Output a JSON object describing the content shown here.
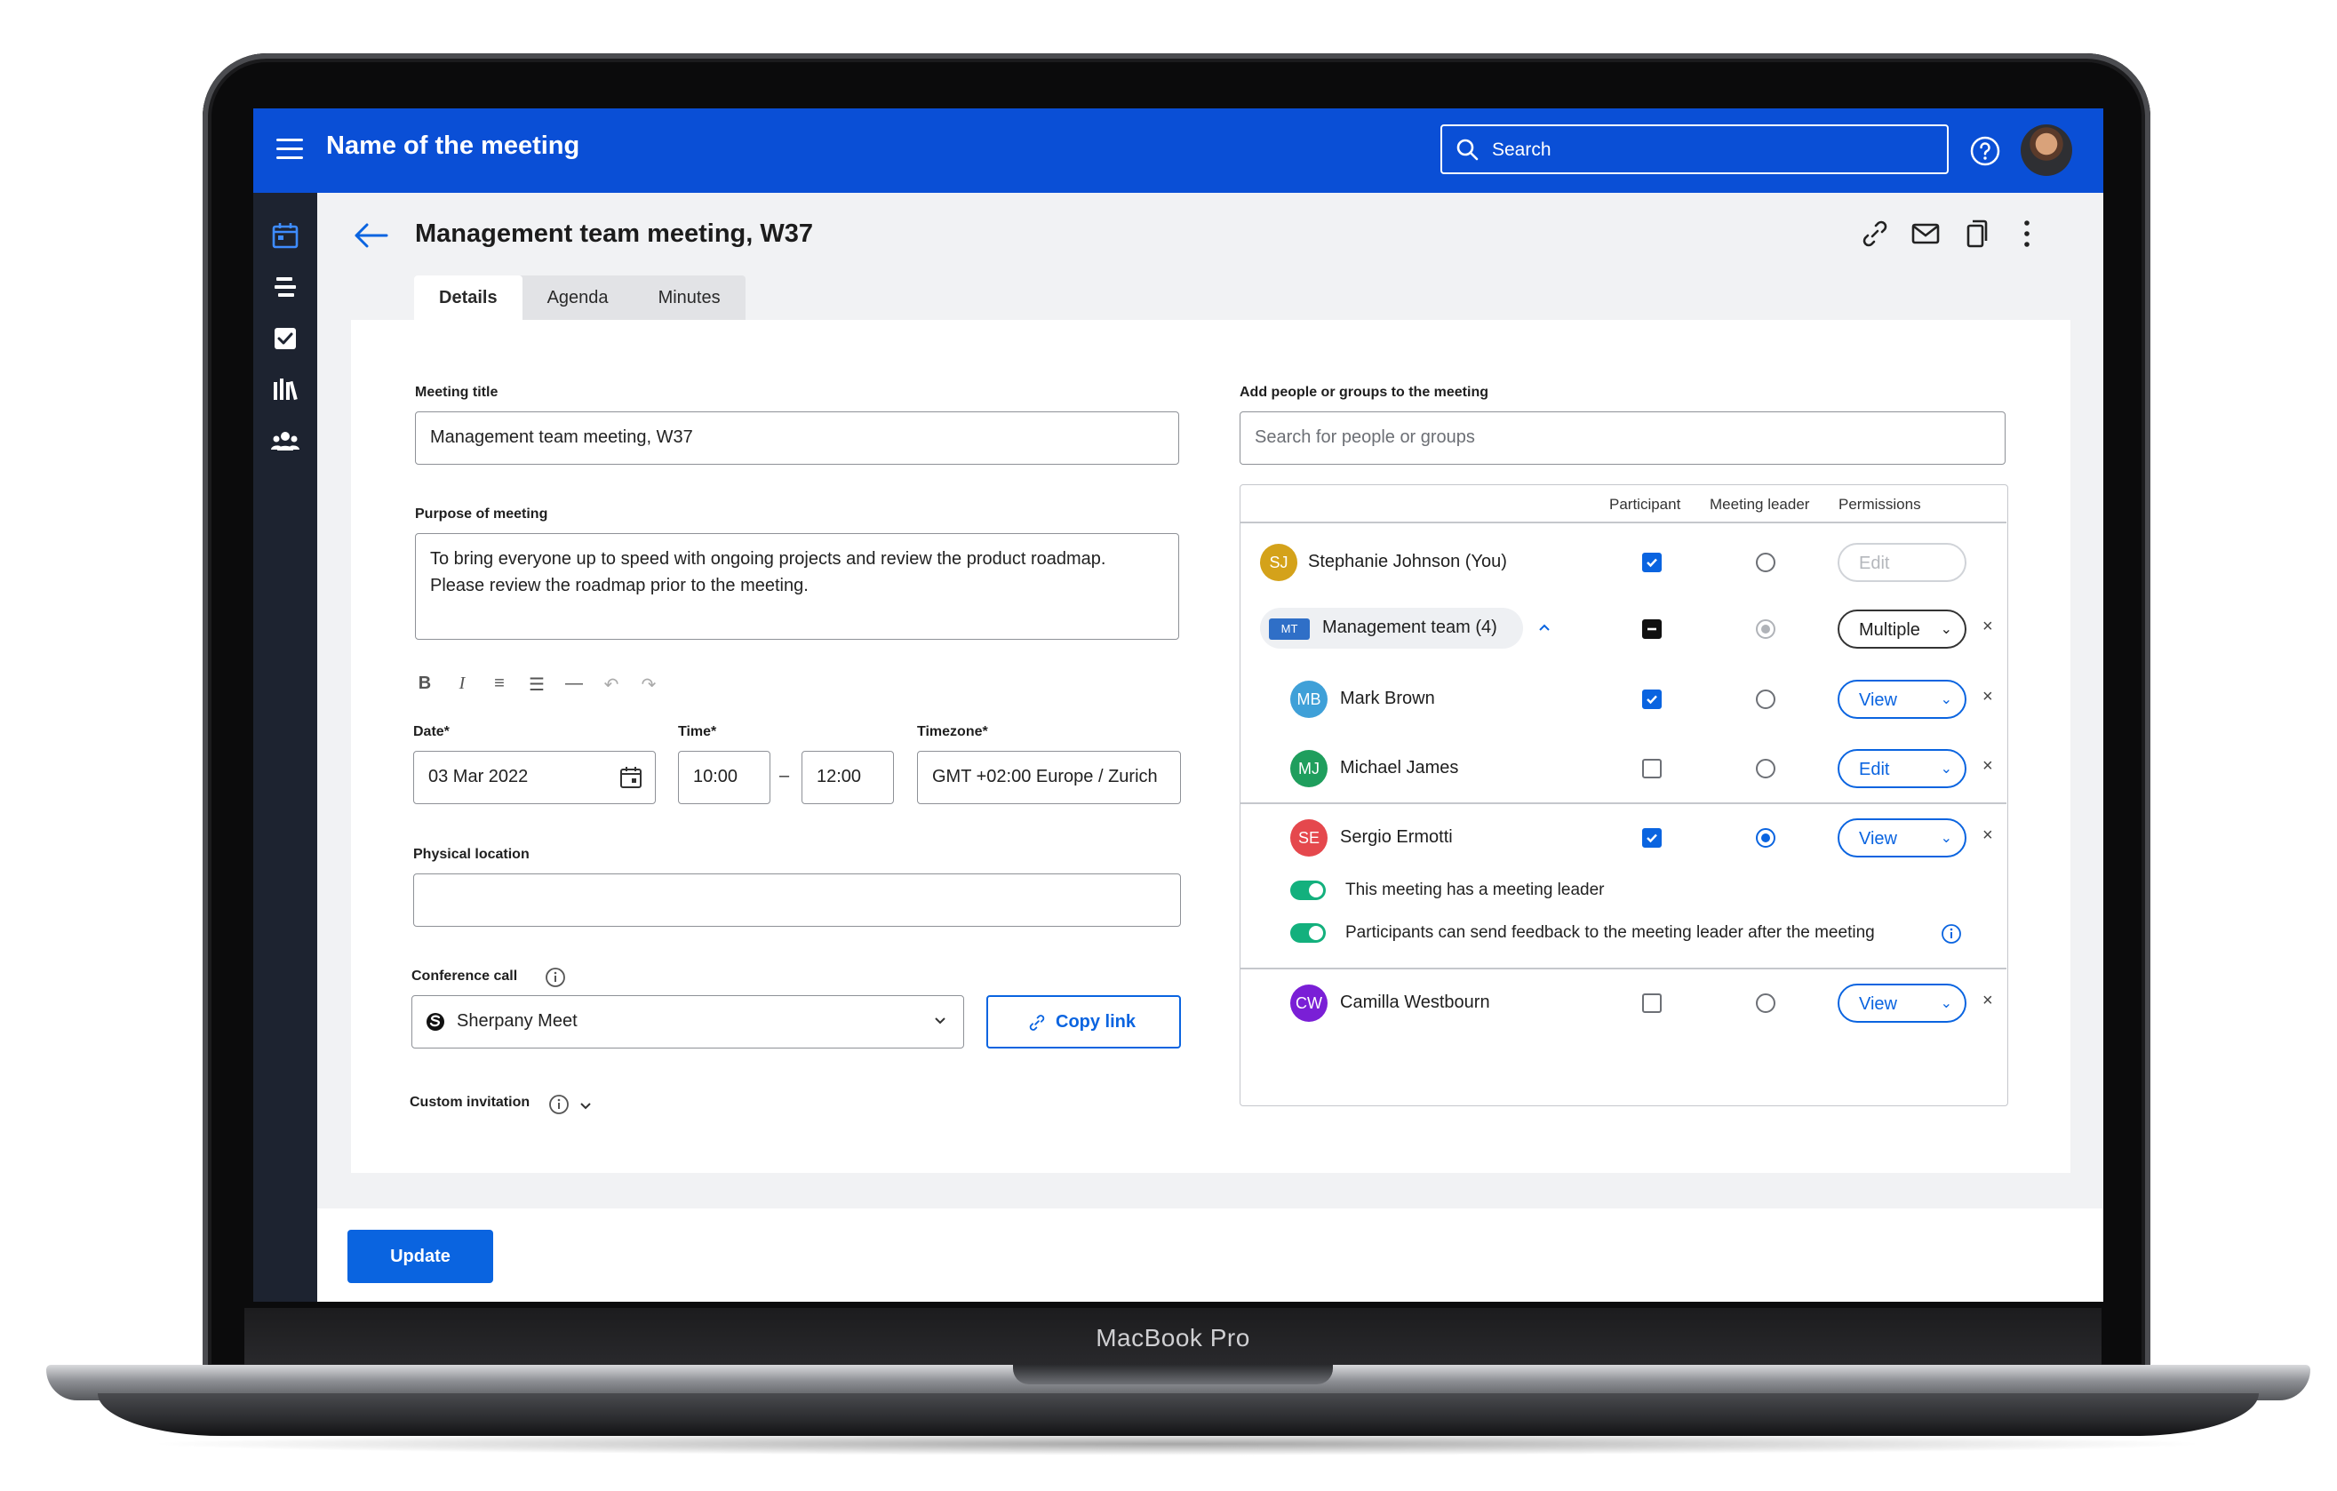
{
  "device": {
    "brand_label": "MacBook Pro"
  },
  "header": {
    "app_title": "Name of the meeting",
    "search_placeholder": "Search",
    "icons": [
      "menu-icon",
      "search-icon",
      "help-icon",
      "avatar"
    ]
  },
  "sidebar": {
    "items": [
      "calendar-icon",
      "agenda-list-icon",
      "tasks-check-icon",
      "library-icon",
      "people-icon"
    ]
  },
  "page": {
    "title": "Management team meeting, W37",
    "actions": [
      "link-icon",
      "mail-icon",
      "copy-icon",
      "more-icon"
    ],
    "tabs": [
      {
        "label": "Details",
        "active": true
      },
      {
        "label": "Agenda",
        "active": false
      },
      {
        "label": "Minutes",
        "active": false
      }
    ]
  },
  "form": {
    "meeting_title_label": "Meeting title",
    "meeting_title_value": "Management team meeting, W37",
    "purpose_label": "Purpose of meeting",
    "purpose_line1": "To bring everyone up to speed with ongoing projects and review the product roadmap.",
    "purpose_line2": "Please review the roadmap prior to the meeting.",
    "rte_tools": [
      "B",
      "I",
      "≡",
      "☰",
      "—",
      "↶",
      "↷"
    ],
    "date_label": "Date*",
    "date_value": "03 Mar 2022",
    "time_label": "Time*",
    "time_start": "10:00",
    "time_sep": "–",
    "time_end": "12:00",
    "timezone_label": "Timezone*",
    "timezone_value": "GMT +02:00 Europe / Zurich",
    "location_label": "Physical location",
    "location_value": "",
    "conference_label": "Conference call",
    "conference_value": "Sherpany Meet",
    "copy_link_label": "Copy link",
    "custom_invitation_label": "Custom invitation"
  },
  "people": {
    "add_label": "Add people or groups to the meeting",
    "search_placeholder": "Search for people or groups",
    "columns": {
      "participant": "Participant",
      "leader": "Meeting leader",
      "permissions": "Permissions"
    },
    "rows": [
      {
        "initials": "SJ",
        "name": "Stephanie Johnson (You)",
        "color": "#d4a21a",
        "participant": "checked",
        "leader": "off",
        "permission": "Edit"
      },
      {
        "initials": "MT",
        "name": "Management team (4)",
        "color": "#2f6fc7",
        "participant": "indeterminate",
        "leader": "disabled",
        "permission": "Multiple"
      },
      {
        "initials": "MB",
        "name": "Mark Brown",
        "color": "#3fa0d8",
        "participant": "checked",
        "leader": "off",
        "permission": "View"
      },
      {
        "initials": "MJ",
        "name": "Michael James",
        "color": "#1f9e5d",
        "participant": "unchecked",
        "leader": "off",
        "permission": "Edit"
      },
      {
        "initials": "SE",
        "name": "Sergio Ermotti",
        "color": "#e5484d",
        "participant": "checked",
        "leader": "on",
        "permission": "View"
      },
      {
        "initials": "CW",
        "name": "Camilla Westbourn",
        "color": "#7a1fd6",
        "participant": "unchecked",
        "leader": "off",
        "permission": "View"
      }
    ],
    "toggle_leader": "This meeting has a meeting leader",
    "toggle_feedback": "Participants can send feedback to the meeting leader after the meeting",
    "remove_symbol": "×"
  },
  "footer": {
    "update_label": "Update"
  },
  "colors": {
    "brand_blue": "#0a4fd6",
    "accent_blue": "#0a64e0",
    "sidebar": "#1d2330",
    "toggle_green": "#13b07d"
  }
}
